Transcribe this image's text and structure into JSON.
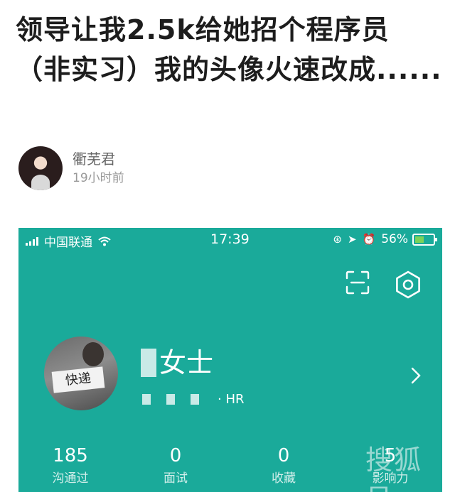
{
  "post": {
    "title": "领导让我2.5k给她招个程序员（非实习）我的头像火速改成......",
    "author": "衢芜君",
    "time": "19小时前"
  },
  "screenshot": {
    "status_bar": {
      "carrier": "中国联通",
      "time": "17:39",
      "battery": "56%",
      "icons": [
        "signal-icon",
        "wifi-icon",
        "rotation-lock-icon",
        "location-icon",
        "alarm-icon",
        "battery-icon"
      ]
    },
    "toolbar_icons": [
      "scan-icon",
      "settings-icon"
    ],
    "profile": {
      "avatar_sign_text": "快递",
      "name": "女士",
      "role": "· HR"
    },
    "stats": [
      {
        "value": "185",
        "label": "沟通过"
      },
      {
        "value": "0",
        "label": "面试"
      },
      {
        "value": "0",
        "label": "收藏"
      },
      {
        "value": "5",
        "label": "影响力"
      }
    ],
    "watermark": "搜狐号",
    "colors": {
      "background": "#1aaa9a",
      "text": "#ffffff",
      "battery_fill": "#7bd35a"
    }
  }
}
